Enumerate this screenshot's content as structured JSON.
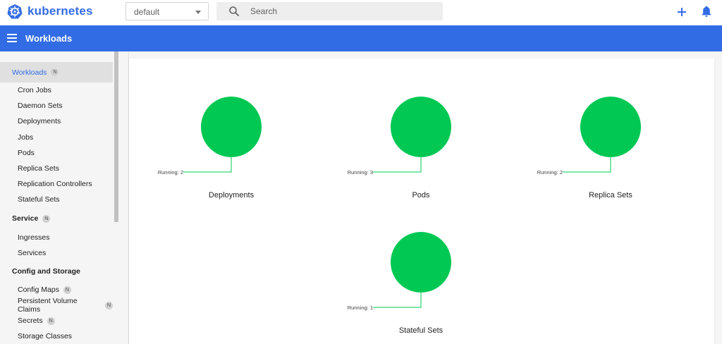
{
  "topbar": {
    "brand": "kubernetes",
    "namespace": "default",
    "search_placeholder": "Search"
  },
  "header": {
    "title": "Workloads"
  },
  "sidebar": {
    "items": [
      {
        "label": "Workloads",
        "type": "active",
        "badge": "N"
      },
      {
        "label": "Cron Jobs",
        "type": "sub"
      },
      {
        "label": "Daemon Sets",
        "type": "sub"
      },
      {
        "label": "Deployments",
        "type": "sub"
      },
      {
        "label": "Jobs",
        "type": "sub"
      },
      {
        "label": "Pods",
        "type": "sub"
      },
      {
        "label": "Replica Sets",
        "type": "sub"
      },
      {
        "label": "Replication Controllers",
        "type": "sub"
      },
      {
        "label": "Stateful Sets",
        "type": "sub"
      },
      {
        "label": "Service",
        "type": "section",
        "badge": "N"
      },
      {
        "label": "Ingresses",
        "type": "sub"
      },
      {
        "label": "Services",
        "type": "sub"
      },
      {
        "label": "Config and Storage",
        "type": "section"
      },
      {
        "label": "Config Maps",
        "type": "sub",
        "badge": "N"
      },
      {
        "label": "Persistent Volume Claims",
        "type": "sub",
        "badge": "N"
      },
      {
        "label": "Secrets",
        "type": "sub",
        "badge": "N"
      },
      {
        "label": "Storage Classes",
        "type": "sub"
      }
    ]
  },
  "charts": [
    {
      "title": "Deployments",
      "status_label": "Running",
      "running": 2
    },
    {
      "title": "Pods",
      "status_label": "Running",
      "running": 3
    },
    {
      "title": "Replica Sets",
      "status_label": "Running",
      "running": 2
    },
    {
      "title": "Stateful Sets",
      "status_label": "Running",
      "running": 1
    }
  ],
  "colors": {
    "brand": "#326ce5",
    "running": "#00c853"
  }
}
